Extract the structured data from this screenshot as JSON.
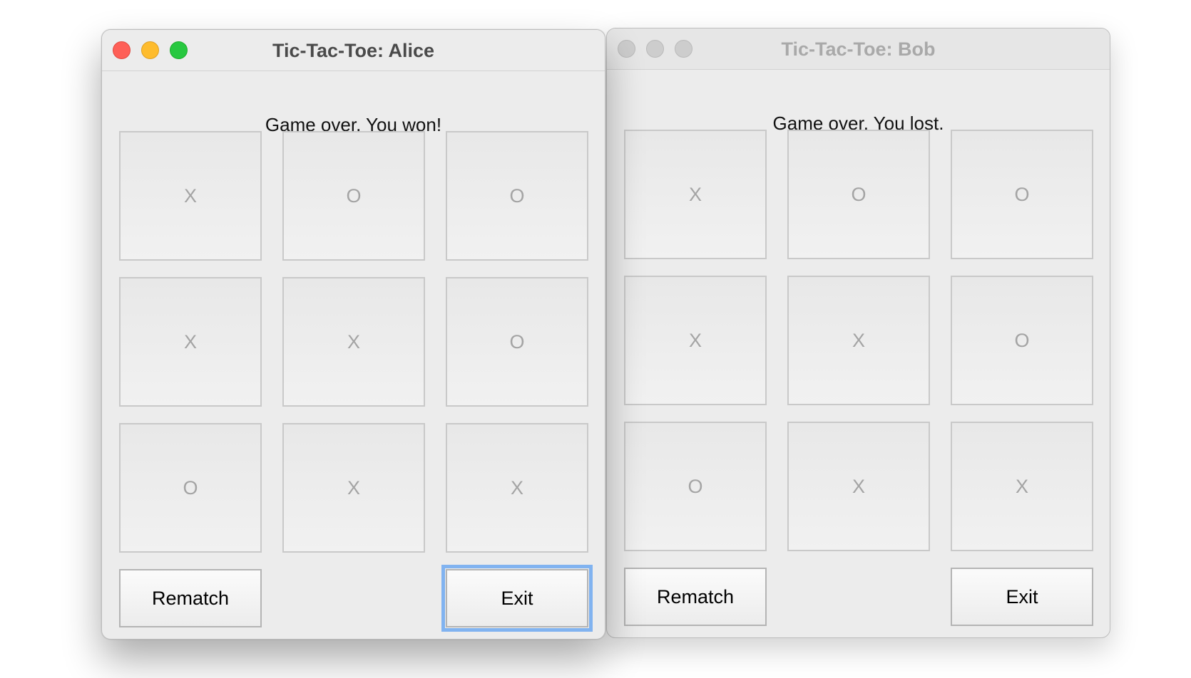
{
  "windows": [
    {
      "title": "Tic-Tac-Toe: Alice",
      "status": "Game over. You won!",
      "board": [
        "X",
        "O",
        "O",
        "X",
        "X",
        "O",
        "O",
        "X",
        "X"
      ],
      "buttons": {
        "rematch": "Rematch",
        "exit": "Exit"
      },
      "active": true,
      "traffic_colors": {
        "close": "#fe5f57",
        "minimize": "#febc2e",
        "maximize": "#28c840"
      }
    },
    {
      "title": "Tic-Tac-Toe: Bob",
      "status": "Game over. You lost.",
      "board": [
        "X",
        "O",
        "O",
        "X",
        "X",
        "O",
        "O",
        "X",
        "X"
      ],
      "buttons": {
        "rematch": "Rematch",
        "exit": "Exit"
      },
      "active": false,
      "traffic_colors": {
        "close": "#cdcdcd",
        "minimize": "#cdcdcd",
        "maximize": "#cdcdcd"
      }
    }
  ],
  "colors": {
    "focus_ring": "#81b3f0",
    "window_bg": "#ececec",
    "mark_color": "#a4a4a4"
  }
}
